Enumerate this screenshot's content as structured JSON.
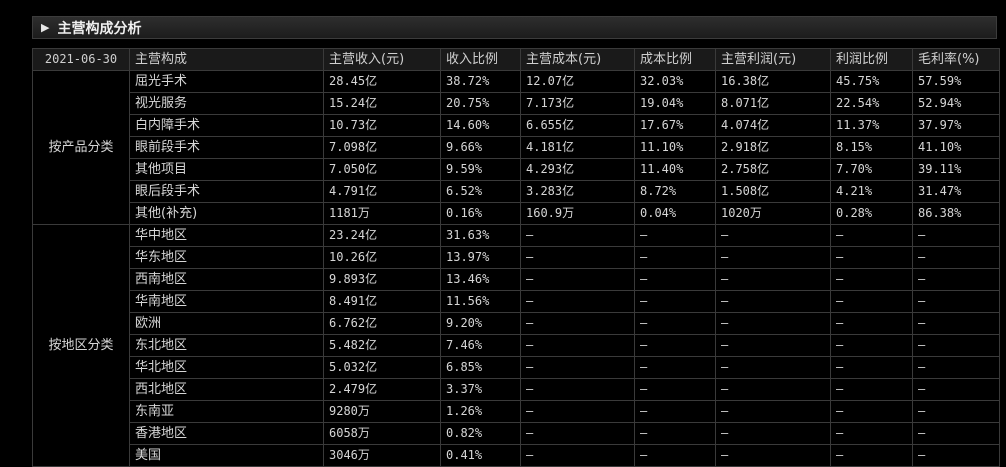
{
  "section": {
    "title": "主营构成分析",
    "arrow_icon": "triangle-right-icon"
  },
  "table": {
    "date": "2021-06-30",
    "columns": [
      "主营构成",
      "主营收入(元)",
      "收入比例",
      "主营成本(元)",
      "成本比例",
      "主营利润(元)",
      "利润比例",
      "毛利率(%)"
    ],
    "groups": [
      {
        "name": "按产品分类",
        "rows": [
          [
            "屈光手术",
            "28.45亿",
            "38.72%",
            "12.07亿",
            "32.03%",
            "16.38亿",
            "45.75%",
            "57.59%"
          ],
          [
            "视光服务",
            "15.24亿",
            "20.75%",
            "7.173亿",
            "19.04%",
            "8.071亿",
            "22.54%",
            "52.94%"
          ],
          [
            "白内障手术",
            "10.73亿",
            "14.60%",
            "6.655亿",
            "17.67%",
            "4.074亿",
            "11.37%",
            "37.97%"
          ],
          [
            "眼前段手术",
            "7.098亿",
            "9.66%",
            "4.181亿",
            "11.10%",
            "2.918亿",
            "8.15%",
            "41.10%"
          ],
          [
            "其他项目",
            "7.050亿",
            "9.59%",
            "4.293亿",
            "11.40%",
            "2.758亿",
            "7.70%",
            "39.11%"
          ],
          [
            "眼后段手术",
            "4.791亿",
            "6.52%",
            "3.283亿",
            "8.72%",
            "1.508亿",
            "4.21%",
            "31.47%"
          ],
          [
            "其他(补充)",
            "1181万",
            "0.16%",
            "160.9万",
            "0.04%",
            "1020万",
            "0.28%",
            "86.38%"
          ]
        ]
      },
      {
        "name": "按地区分类",
        "rows": [
          [
            "华中地区",
            "23.24亿",
            "31.63%",
            "—",
            "—",
            "—",
            "—",
            "—"
          ],
          [
            "华东地区",
            "10.26亿",
            "13.97%",
            "—",
            "—",
            "—",
            "—",
            "—"
          ],
          [
            "西南地区",
            "9.893亿",
            "13.46%",
            "—",
            "—",
            "—",
            "—",
            "—"
          ],
          [
            "华南地区",
            "8.491亿",
            "11.56%",
            "—",
            "—",
            "—",
            "—",
            "—"
          ],
          [
            "欧洲",
            "6.762亿",
            "9.20%",
            "—",
            "—",
            "—",
            "—",
            "—"
          ],
          [
            "东北地区",
            "5.482亿",
            "7.46%",
            "—",
            "—",
            "—",
            "—",
            "—"
          ],
          [
            "华北地区",
            "5.032亿",
            "6.85%",
            "—",
            "—",
            "—",
            "—",
            "—"
          ],
          [
            "西北地区",
            "2.479亿",
            "3.37%",
            "—",
            "—",
            "—",
            "—",
            "—"
          ],
          [
            "东南亚",
            "9280万",
            "1.26%",
            "—",
            "—",
            "—",
            "—",
            "—"
          ],
          [
            "香港地区",
            "6058万",
            "0.82%",
            "—",
            "—",
            "—",
            "—",
            "—"
          ],
          [
            "美国",
            "3046万",
            "0.41%",
            "—",
            "—",
            "—",
            "—",
            "—"
          ]
        ]
      }
    ]
  }
}
